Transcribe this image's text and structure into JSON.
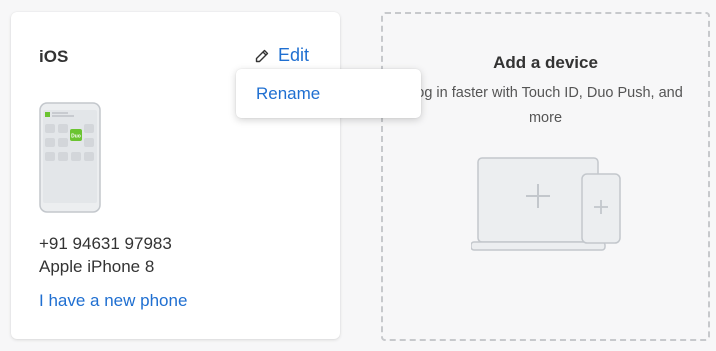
{
  "device_card": {
    "title": "iOS",
    "edit_label": "Edit",
    "phone_number": "+91 94631 97983",
    "phone_model": "Apple iPhone 8",
    "new_phone_link": "I have a new phone"
  },
  "phone_illustration": {
    "app_badge": "Duo"
  },
  "edit_menu": {
    "items": [
      "Rename"
    ]
  },
  "add_device": {
    "title": "Add a device",
    "subtitle": "Log in faster with Touch ID, Duo Push, and more"
  },
  "colors": {
    "link": "#1f6fd1",
    "duo_green": "#6bc431",
    "background": "#f7f7f8"
  },
  "icons": {
    "edit": "pencil-icon",
    "add_laptop": "plus-icon",
    "add_phone": "plus-icon"
  }
}
